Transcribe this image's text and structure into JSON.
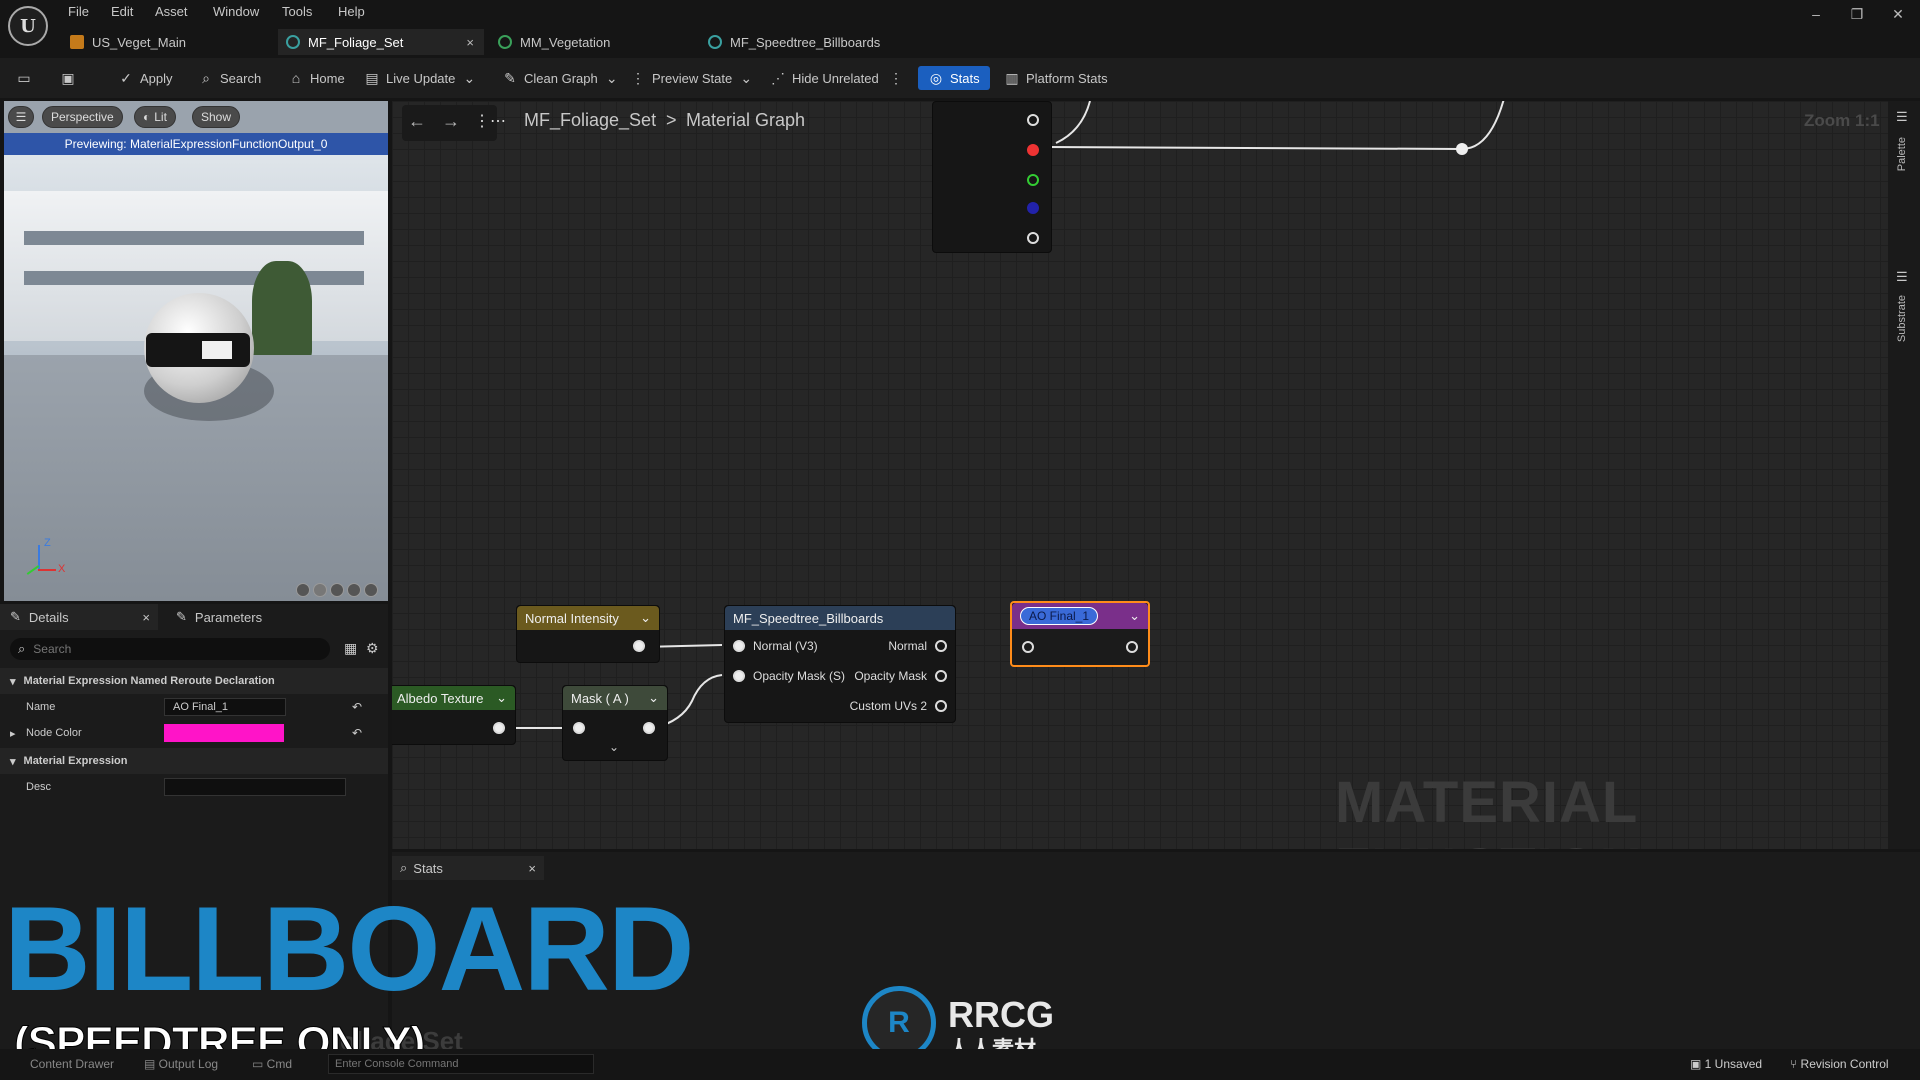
{
  "menu": {
    "items": [
      "File",
      "Edit",
      "Asset",
      "Window",
      "Tools",
      "Help"
    ]
  },
  "tabs": [
    {
      "label": "US_Veget_Main",
      "active": false
    },
    {
      "label": "MF_Foliage_Set",
      "active": true,
      "close": "×"
    },
    {
      "label": "MM_Vegetation",
      "active": false
    },
    {
      "label": "MF_Speedtree_Billboards",
      "active": false
    }
  ],
  "window": {
    "minimize": "–",
    "restore": "❐",
    "close": "✕"
  },
  "toolbar": {
    "apply": "Apply",
    "search": "Search",
    "home": "Home",
    "live_update": "Live Update",
    "clean_graph": "Clean Graph",
    "preview_state": "Preview State",
    "hide_unrelated": "Hide Unrelated",
    "stats": "Stats",
    "platform_stats": "Platform Stats"
  },
  "viewport": {
    "perspective": "Perspective",
    "lit": "Lit",
    "show": "Show",
    "previewing": "Previewing: MaterialExpressionFunctionOutput_0",
    "axis_z": "Z",
    "axis_x": "X"
  },
  "graph": {
    "breadcrumb_root": "MF_Foliage_Set",
    "breadcrumb_sep": ">",
    "breadcrumb_leaf": "Material Graph",
    "zoom": "Zoom 1:1",
    "watermark": "MATERIAL FUNCTION",
    "nodes": {
      "normal_intensity": "Normal Intensity",
      "albedo_texture": "Albedo Texture",
      "mask": "Mask ( A )",
      "speedtree": {
        "title": "MF_Speedtree_Billboards",
        "in1": "Normal (V3)",
        "in2": "Opacity Mask (S)",
        "out1": "Normal",
        "out2": "Opacity Mask",
        "out3": "Custom UVs 2"
      },
      "reroute_name": "AO Final_1"
    }
  },
  "side_rail": {
    "palette": "Palette",
    "substrate": "Substrate"
  },
  "details": {
    "tab_details": "Details",
    "tab_parameters": "Parameters",
    "search_placeholder": "Search",
    "section1": "Material Expression Named Reroute Declaration",
    "name_label": "Name",
    "name_value": "AO Final_1",
    "node_color_label": "Node Color",
    "node_color": "#ff14c8",
    "section2": "Material Expression",
    "desc_label": "Desc",
    "desc_value": ""
  },
  "stats_panel": {
    "title": "Stats"
  },
  "overlay": {
    "billboard": "BILLBOARD",
    "speedtree": "(SPEEDTREE ONLY)",
    "foliage_set_text": "oliage Set",
    "rrcg": "RRCG",
    "rrcg_cn": "人人素材"
  },
  "statusbar": {
    "content_drawer": "Content Drawer",
    "output_log": "Output Log",
    "cmd": "Cmd",
    "console_placeholder": "Enter Console Command",
    "unsaved": "1 Unsaved",
    "revision_control": "Revision Control"
  },
  "colors": {
    "accent": "#1b5fbf",
    "normal_intensity_head": "#6b5a1e",
    "albedo_head": "#2b5a24",
    "mask_head": "#3e4a3a",
    "speedtree_head": "#2c3f57",
    "reroute_head": "#7a2f8a",
    "reroute_border": "#ff8c1a",
    "overlay_blue": "#1d86c6"
  }
}
